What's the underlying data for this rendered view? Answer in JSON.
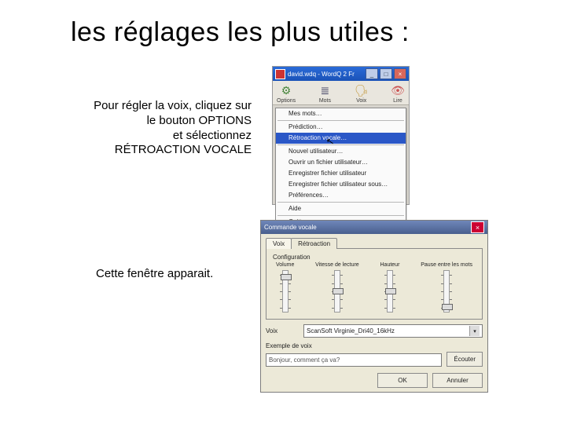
{
  "slide": {
    "title": "les réglages les plus utiles :",
    "intro_l1": "Pour régler la voix, cliquez sur",
    "intro_l2": "le bouton OPTIONS",
    "intro_l3": "et sélectionnez",
    "intro_l4": "RÉTROACTION VOCALE",
    "caption2": "Cette fenêtre apparait."
  },
  "shot1": {
    "titlebar": "david.wdq - WordQ 2 Fr",
    "min": "_",
    "max": "□",
    "close": "×",
    "tools": {
      "options": {
        "glyph": "⚙",
        "label": "Options"
      },
      "words": {
        "glyph": "≣",
        "label": "Mots"
      },
      "voice": {
        "glyph": "🗣",
        "label": "Voix"
      },
      "read": {
        "glyph": "👁",
        "label": "Lire"
      }
    },
    "menu": {
      "mywords": "Mes mots…",
      "prediction": "Prédiction…",
      "feedback": "Rétroaction vocale…",
      "newuser": "Nouvel utilisateur…",
      "openuser": "Ouvrir un fichier utilisateur…",
      "saveuser": "Enregistrer fichier utilisateur",
      "saveuseras": "Enregistrer fichier utilisateur sous…",
      "prefs": "Préférences…",
      "help": "Aide",
      "quit": "Quitter"
    }
  },
  "shot2": {
    "title": "Commande vocale",
    "close": "×",
    "tab_voice": "Voix",
    "tab_feedback": "Rétroaction",
    "group": "Configuration",
    "sliders": {
      "volume": {
        "label": "Volume"
      },
      "rate": {
        "label": "Vitesse de lecture"
      },
      "pitch": {
        "label": "Hauteur"
      },
      "wordgap": {
        "label": "Pause entre\nles mots"
      }
    },
    "voice_lbl": "Voix",
    "voice_value": "ScanSoft Virginie_Dri40_16kHz",
    "dd": "▾",
    "example_lbl": "Exemple de voix",
    "example_value": "Bonjour, comment ça va?",
    "listen": "Écouter",
    "ok": "OK",
    "cancel": "Annuler"
  }
}
